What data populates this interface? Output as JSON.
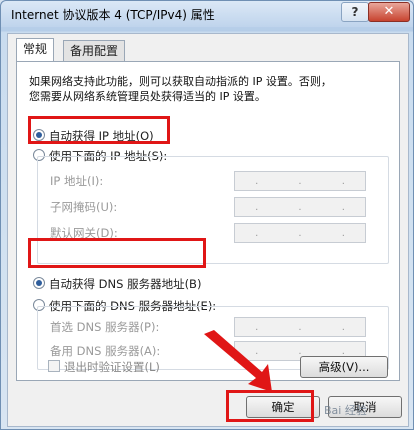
{
  "window": {
    "title": "Internet 协议版本 4 (TCP/IPv4) 属性",
    "help_label": "?",
    "close_label": "✕"
  },
  "tabs": [
    {
      "label": "常规"
    },
    {
      "label": "备用配置"
    }
  ],
  "description": {
    "line1": "如果网络支持此功能，则可以获取自动指派的 IP 设置。否则，",
    "line2": "您需要从网络系统管理员处获得适当的 IP 设置。"
  },
  "ip_section": {
    "auto_label": "自动获得 IP 地址(O)",
    "manual_label": "使用下面的 IP 地址(S):",
    "fields": [
      {
        "label": "IP 地址(I):"
      },
      {
        "label": "子网掩码(U):"
      },
      {
        "label": "默认网关(D):"
      }
    ]
  },
  "dns_section": {
    "auto_label": "自动获得 DNS 服务器地址(B)",
    "manual_label": "使用下面的 DNS 服务器地址(E):",
    "fields": [
      {
        "label": "首选 DNS 服务器(P):"
      },
      {
        "label": "备用 DNS 服务器(A):"
      }
    ]
  },
  "validate_on_exit": {
    "label": "退出时验证设置(L)"
  },
  "buttons": {
    "advanced": "高级(V)...",
    "ok": "确定",
    "cancel": "取消"
  },
  "ip_separator": ".",
  "watermark": "Bai 经验",
  "colors": {
    "highlight": "#e01616",
    "title_close": "#c7432f",
    "radio_selected": "#2f5e9c"
  }
}
